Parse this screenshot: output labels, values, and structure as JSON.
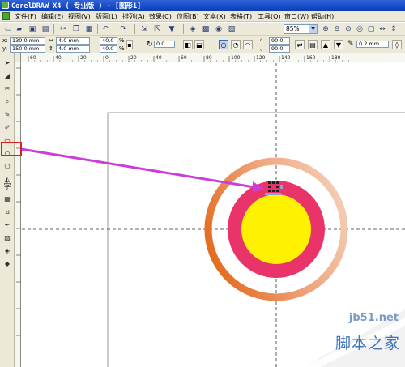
{
  "window": {
    "title": "CorelDRAW X4 ( 专业版 ) - [图形1]"
  },
  "menu": [
    "文件(F)",
    "编辑(E)",
    "视图(V)",
    "版面(L)",
    "排列(A)",
    "效果(C)",
    "位图(B)",
    "文本(X)",
    "表格(T)",
    "工具(O)",
    "窗口(W)",
    "帮助(H)"
  ],
  "toolbar": {
    "zoom": "85%"
  },
  "properties": {
    "x_label": "x:",
    "x": "130.0 mm",
    "y_label": "y:",
    "y": "150.0 mm",
    "w": "4.0 mm",
    "h": "4.0 mm",
    "scale_w": "40.0",
    "scale_h": "40.0",
    "scale_unit": "%",
    "rotation": "0.0",
    "start_angle": "90.0",
    "end_angle": "90.0",
    "outline_width": "0.2 mm"
  },
  "ruler": {
    "h_ticks": [
      "60",
      "40",
      "20",
      "0",
      "20",
      "40",
      "60",
      "80",
      "100",
      "120",
      "140",
      "160",
      "180"
    ],
    "v_ticks": [
      "280",
      "260",
      "240",
      "220",
      "200",
      "180",
      "160",
      "140",
      "120",
      "100",
      "80"
    ]
  },
  "toolbox": {
    "text_tool_glyph": "字"
  },
  "colors": {
    "outer_ring_start": "#e36a1d",
    "outer_ring_end": "#f4cdb5",
    "middle_circle": "#e93469",
    "inner_circle": "#fff200",
    "arrow": "#cc3dd8",
    "guide": "#333333"
  },
  "watermark": {
    "site": "jb51.net",
    "text": "脚本之家"
  }
}
